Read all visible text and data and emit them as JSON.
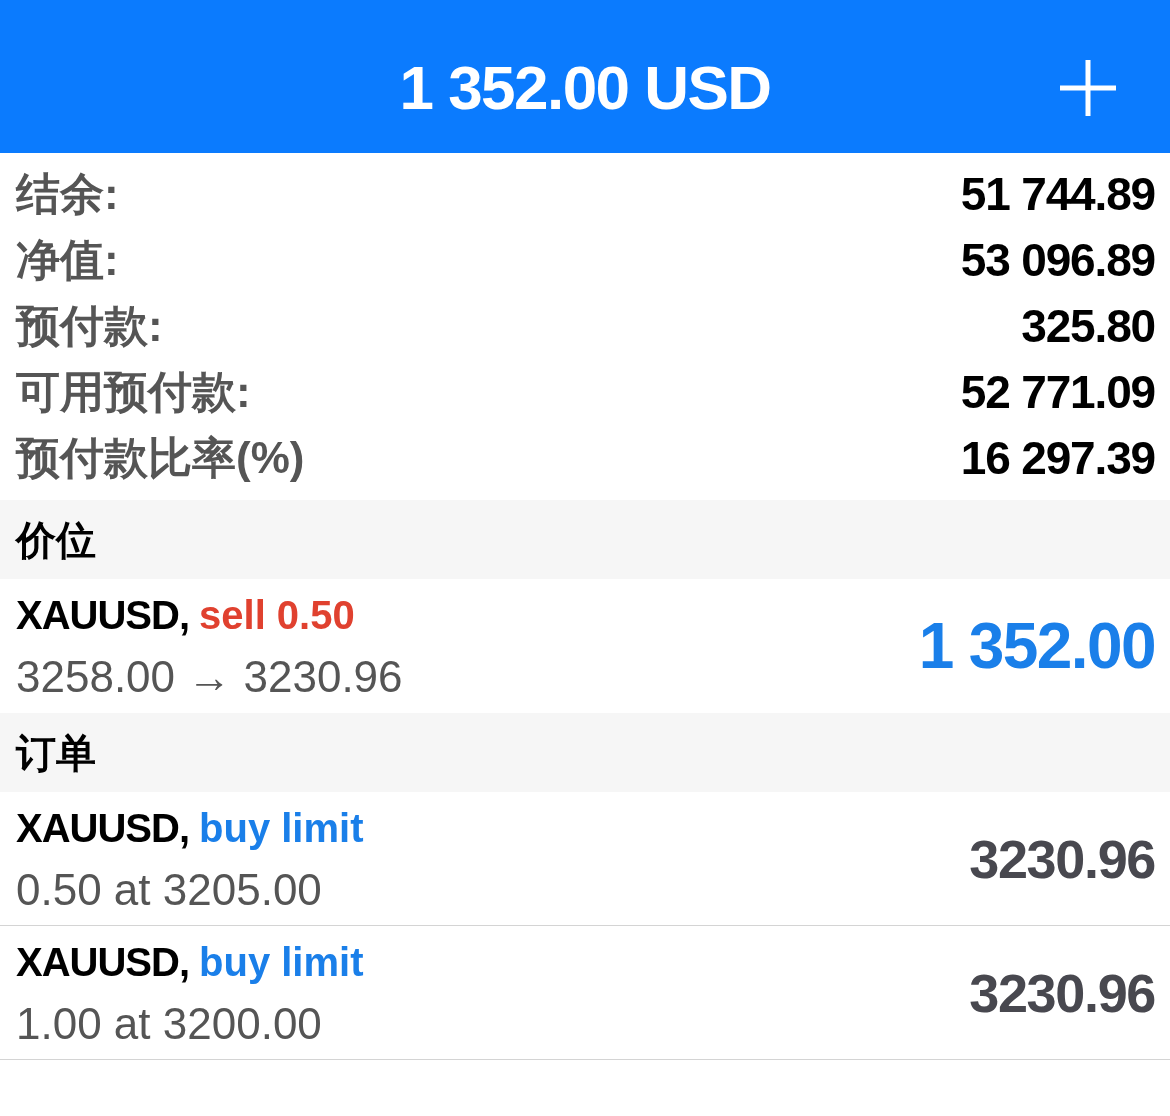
{
  "header": {
    "title": "1 352.00 USD"
  },
  "summary": [
    {
      "label": "结余:",
      "value": "51 744.89"
    },
    {
      "label": "净值:",
      "value": "53 096.89"
    },
    {
      "label": "预付款:",
      "value": "325.80"
    },
    {
      "label": "可用预付款:",
      "value": "52 771.09"
    },
    {
      "label": "预付款比率(%)",
      "value": "16 297.39"
    }
  ],
  "sections": [
    {
      "title": "价位",
      "kind": "positions",
      "items": [
        {
          "symbol": "XAUUSD,",
          "order_type": "sell 0.50",
          "color": "#e0412f",
          "detail": "3258.00 → 3230.96",
          "value": "1 352.00"
        }
      ]
    },
    {
      "title": "订单",
      "kind": "orders",
      "items": [
        {
          "symbol": "XAUUSD,",
          "order_type": "buy limit",
          "color": "#1a7fe9",
          "detail": "0.50 at 3205.00",
          "value": "3230.96"
        },
        {
          "symbol": "XAUUSD,",
          "order_type": "buy limit",
          "color": "#1a7fe9",
          "detail": "1.00 at 3200.00",
          "value": "3230.96"
        }
      ]
    }
  ]
}
